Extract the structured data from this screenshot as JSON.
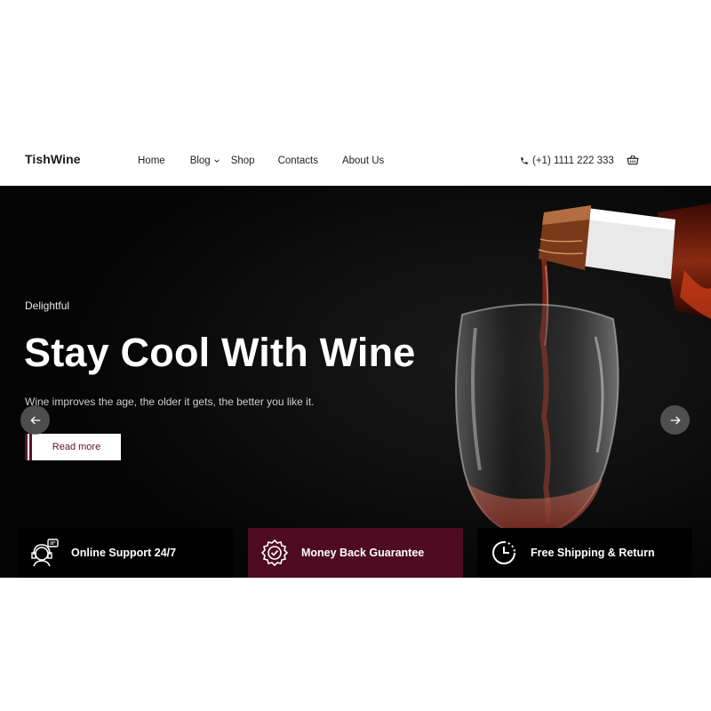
{
  "header": {
    "logo": "TishWine",
    "nav": {
      "home": "Home",
      "blog": "Blog",
      "shop": "Shop",
      "contacts": "Contacts",
      "about": "About Us"
    },
    "phone": "(+1) 1111 222 333"
  },
  "hero": {
    "subtitle": "Delightful",
    "title": "Stay Cool With Wine",
    "description": "Wine improves the age, the older it gets, the better you like it.",
    "cta": "Read more"
  },
  "features": [
    {
      "label": "Online Support 24/7",
      "icon": "support-icon"
    },
    {
      "label": "Money Back Guarantee",
      "icon": "guarantee-badge-icon"
    },
    {
      "label": "Free Shipping & Return",
      "icon": "clock-icon"
    }
  ],
  "colors": {
    "accent": "#4f0b21",
    "hero_bg": "#070707"
  }
}
